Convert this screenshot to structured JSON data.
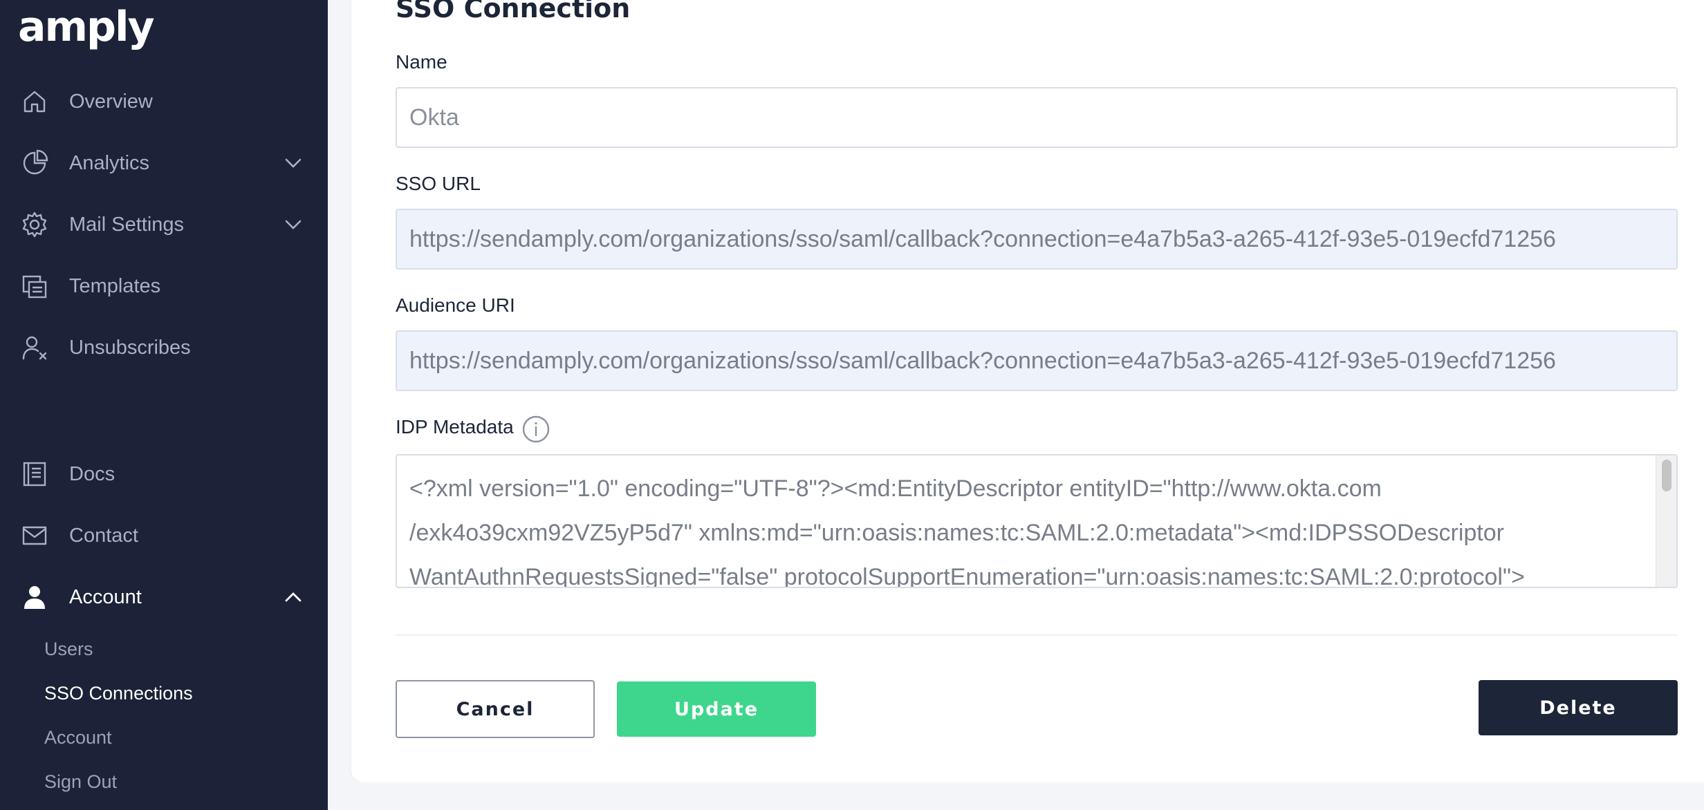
{
  "app": {
    "logo": "amply"
  },
  "sidebar": {
    "items": [
      {
        "label": "Overview",
        "icon": "home-icon"
      },
      {
        "label": "Analytics",
        "icon": "pie-chart-icon",
        "expandable": true,
        "expanded": false
      },
      {
        "label": "Mail Settings",
        "icon": "gear-icon",
        "expandable": true,
        "expanded": false
      },
      {
        "label": "Templates",
        "icon": "templates-icon"
      },
      {
        "label": "Unsubscribes",
        "icon": "user-x-icon"
      },
      {
        "label": "Docs",
        "icon": "book-icon"
      },
      {
        "label": "Contact",
        "icon": "mail-icon"
      },
      {
        "label": "Account",
        "icon": "user-icon",
        "expandable": true,
        "expanded": true,
        "active": true
      }
    ],
    "account_subitems": [
      {
        "label": "Users"
      },
      {
        "label": "SSO Connections",
        "active": true
      },
      {
        "label": "Account"
      },
      {
        "label": "Sign Out"
      }
    ]
  },
  "main": {
    "title": "SSO Connection",
    "fields": {
      "name": {
        "label": "Name",
        "value": "Okta"
      },
      "sso_url": {
        "label": "SSO URL",
        "value": "https://sendamply.com/organizations/sso/saml/callback?connection=e4a7b5a3-a265-412f-93e5-019ecfd71256"
      },
      "audience_uri": {
        "label": "Audience URI",
        "value": "https://sendamply.com/organizations/sso/saml/callback?connection=e4a7b5a3-a265-412f-93e5-019ecfd71256"
      },
      "idp_metadata": {
        "label": "IDP Metadata",
        "value": "<?xml version=\"1.0\" encoding=\"UTF-8\"?><md:EntityDescriptor entityID=\"http://www.okta.com\n/exk4o39cxm92VZ5yP5d7\" xmlns:md=\"urn:oasis:names:tc:SAML:2.0:metadata\"><md:IDPSSODescriptor\nWantAuthnRequestsSigned=\"false\" protocolSupportEnumeration=\"urn:oasis:names:tc:SAML:2.0:protocol\">"
      }
    },
    "buttons": {
      "cancel": "Cancel",
      "update": "Update",
      "delete": "Delete"
    }
  },
  "colors": {
    "sidebar_bg": "#1c2237",
    "accent_green": "#3dd68c",
    "dark_button": "#1d2538",
    "readonly_bg": "#eef2fa"
  }
}
